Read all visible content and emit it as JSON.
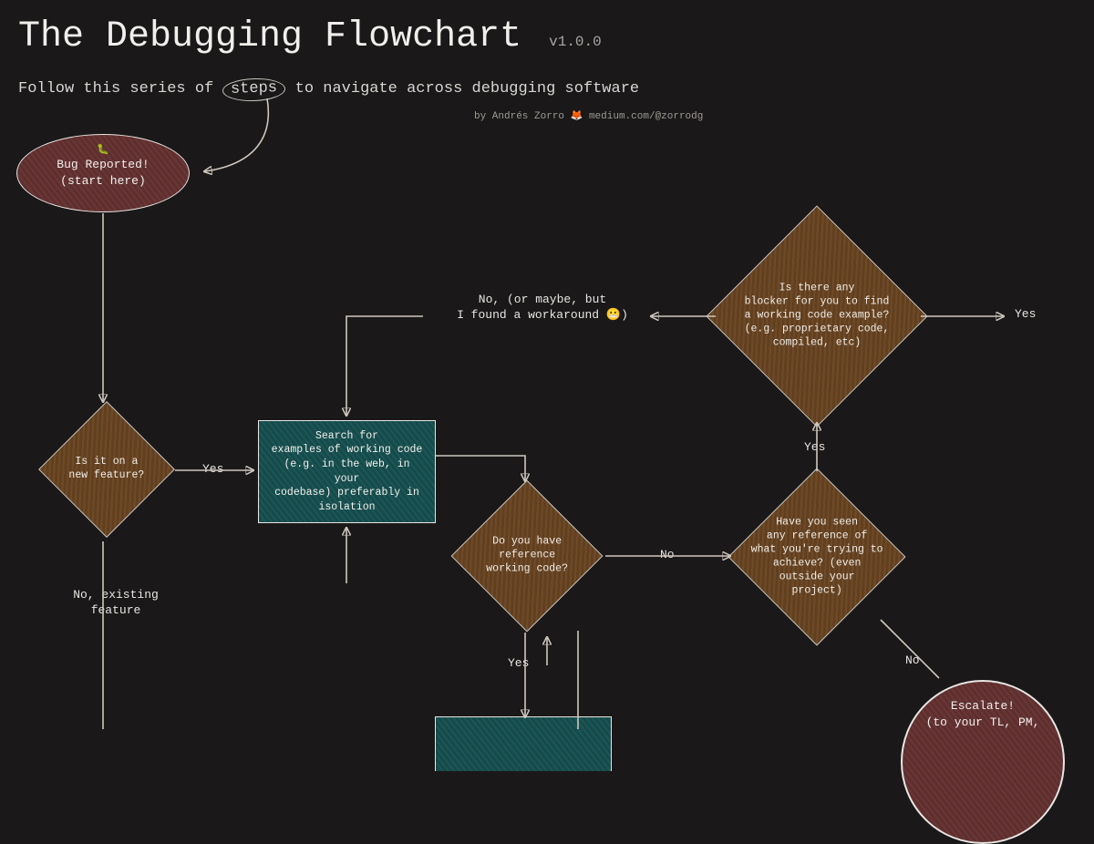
{
  "title": "The Debugging Flowchart",
  "version": "v1.0.0",
  "subtitle_pre": "Follow this series of ",
  "subtitle_circled": "steps",
  "subtitle_post": " to navigate across debugging software",
  "byline_pre": "by Andrés Zorro ",
  "byline_link": "medium.com/@zorrodg",
  "nodes": {
    "start": {
      "label": "Bug Reported!\n(start here)",
      "bug_emoji": "🐛"
    },
    "new_feature": {
      "label": "Is it on a\nnew feature?"
    },
    "search_examples": {
      "label": "Search for\nexamples of working code\n(e.g. in the web, in your\ncodebase) preferably in\nisolation"
    },
    "ref_code": {
      "label": "Do you have\nreference\nworking code?"
    },
    "seen_ref": {
      "label": "Have you seen\nany reference of\nwhat you're trying to\nachieve? (even\noutside your\nproject)"
    },
    "blocker": {
      "label": "Is there any\nblocker for you to find\na working code example?\n(e.g. proprietary code,\ncompiled, etc)"
    },
    "escalate": {
      "label": "Escalate!\n(to your TL, PM,"
    }
  },
  "edges": {
    "yes_feature": "Yes",
    "no_existing": "No, existing\nfeature",
    "no_ref": "No",
    "yes_ref": "Yes",
    "yes_seen": "Yes",
    "no_seen": "No",
    "no_blocker": "No, (or maybe, but\nI found a workaround 😬)",
    "yes_blocker": "Yes"
  }
}
